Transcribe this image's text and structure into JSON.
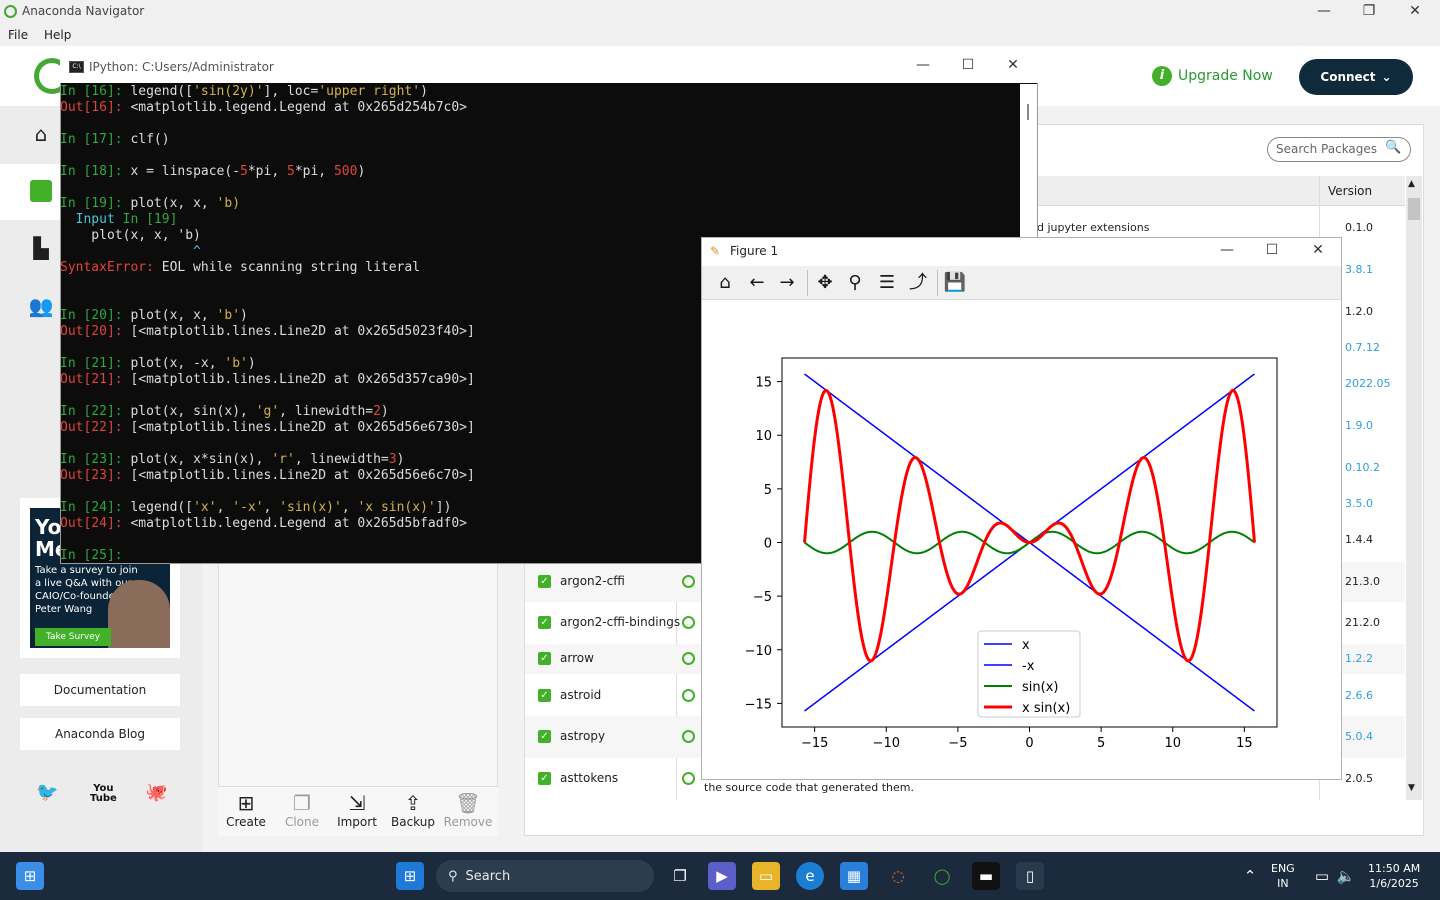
{
  "navigator": {
    "title": "Anaconda Navigator",
    "menu": [
      "File",
      "Help"
    ],
    "upgrade_label": "Upgrade Now",
    "connect_label": "Connect",
    "promo": {
      "headline": "Yo\nMe",
      "body": "Take a survey to join a live Q&A with our CAIO/Co-founder, Peter Wang",
      "button": "Take Survey"
    },
    "links": [
      "Documentation",
      "Anaconda Blog"
    ],
    "env_tools": [
      {
        "label": "Create",
        "icon": "plus-square-icon",
        "enabled": true
      },
      {
        "label": "Clone",
        "icon": "clone-icon",
        "enabled": false
      },
      {
        "label": "Import",
        "icon": "import-icon",
        "enabled": true
      },
      {
        "label": "Backup",
        "icon": "upload-icon",
        "enabled": true
      },
      {
        "label": "Remove",
        "icon": "trash-icon",
        "enabled": false
      }
    ],
    "search_placeholder": "Search Packages",
    "version_header": "Version",
    "top_description": "d jupyter extensions",
    "bottom_description": "the source code that generated them.",
    "versions_top": [
      {
        "v": "0.1.0",
        "update": false
      },
      {
        "v": "3.8.1",
        "update": true
      },
      {
        "v": "1.2.0",
        "update": false
      },
      {
        "v": "0.7.12",
        "update": true
      },
      {
        "v": "2022.05",
        "update": true
      },
      {
        "v": "1.9.0",
        "update": true
      },
      {
        "v": "0.10.2",
        "update": true
      },
      {
        "v": "3.5.0",
        "update": true
      },
      {
        "v": "1.4.4",
        "update": false
      }
    ],
    "packages": [
      {
        "name": "argon2-cffi",
        "version": "21.3.0",
        "update": false
      },
      {
        "name": "argon2-cffi-bindings",
        "version": "21.2.0",
        "update": false
      },
      {
        "name": "arrow",
        "version": "1.2.2",
        "update": true
      },
      {
        "name": "astroid",
        "version": "2.6.6",
        "update": true
      },
      {
        "name": "astropy",
        "version": "5.0.4",
        "update": true
      },
      {
        "name": "asttokens",
        "version": "2.0.5",
        "update": false
      }
    ]
  },
  "ipython": {
    "title": "IPython: C:Users/Administrator",
    "lines": [
      [
        [
          "c-in",
          "In [16]: "
        ],
        [
          "",
          "legend(["
        ],
        [
          "c-str",
          "'sin(2y)'"
        ],
        [
          "",
          "], loc="
        ],
        [
          "c-str",
          "'upper right'"
        ],
        [
          "",
          ")"
        ]
      ],
      [
        [
          "c-out",
          "Out[16]: "
        ],
        [
          "",
          "<matplotlib.legend.Legend at 0x265d254b7c0>"
        ]
      ],
      [],
      [
        [
          "c-in",
          "In [17]: "
        ],
        [
          "",
          "clf()"
        ]
      ],
      [],
      [
        [
          "c-in",
          "In [18]: "
        ],
        [
          "",
          "x = linspace(-"
        ],
        [
          "c-num",
          "5"
        ],
        [
          "",
          "*pi, "
        ],
        [
          "c-num",
          "5"
        ],
        [
          "",
          "*pi, "
        ],
        [
          "c-num",
          "500"
        ],
        [
          "",
          ")"
        ]
      ],
      [],
      [
        [
          "c-in",
          "In [19]: "
        ],
        [
          "",
          "plot(x, x, "
        ],
        [
          "c-str",
          "'b)"
        ]
      ],
      [
        [
          "c-cyan",
          "  Input "
        ],
        [
          "c-in",
          "In [19]"
        ]
      ],
      [
        [
          "",
          "    plot(x, x, 'b)"
        ]
      ],
      [
        [
          "c-cyan",
          "                 ^"
        ]
      ],
      [
        [
          "c-err",
          "SyntaxError:"
        ],
        [
          "",
          " EOL while scanning string literal"
        ]
      ],
      [],
      [],
      [
        [
          "c-in",
          "In [20]: "
        ],
        [
          "",
          "plot(x, x, "
        ],
        [
          "c-str",
          "'b'"
        ],
        [
          "",
          ")"
        ]
      ],
      [
        [
          "c-out",
          "Out[20]: "
        ],
        [
          "",
          "[<matplotlib.lines.Line2D at 0x265d5023f40>]"
        ]
      ],
      [],
      [
        [
          "c-in",
          "In [21]: "
        ],
        [
          "",
          "plot(x, -x, "
        ],
        [
          "c-str",
          "'b'"
        ],
        [
          "",
          ")"
        ]
      ],
      [
        [
          "c-out",
          "Out[21]: "
        ],
        [
          "",
          "[<matplotlib.lines.Line2D at 0x265d357ca90>]"
        ]
      ],
      [],
      [
        [
          "c-in",
          "In [22]: "
        ],
        [
          "",
          "plot(x, sin(x), "
        ],
        [
          "c-str",
          "'g'"
        ],
        [
          "",
          ", linewidth="
        ],
        [
          "c-num",
          "2"
        ],
        [
          "",
          ")"
        ]
      ],
      [
        [
          "c-out",
          "Out[22]: "
        ],
        [
          "",
          "[<matplotlib.lines.Line2D at 0x265d56e6730>]"
        ]
      ],
      [],
      [
        [
          "c-in",
          "In [23]: "
        ],
        [
          "",
          "plot(x, x*sin(x), "
        ],
        [
          "c-str",
          "'r'"
        ],
        [
          "",
          ", linewidth="
        ],
        [
          "c-num",
          "3"
        ],
        [
          "",
          ")"
        ]
      ],
      [
        [
          "c-out",
          "Out[23]: "
        ],
        [
          "",
          "[<matplotlib.lines.Line2D at 0x265d56e6c70>]"
        ]
      ],
      [],
      [
        [
          "c-in",
          "In [24]: "
        ],
        [
          "",
          "legend(["
        ],
        [
          "c-str",
          "'x'"
        ],
        [
          "",
          ", "
        ],
        [
          "c-str",
          "'-x'"
        ],
        [
          "",
          ", "
        ],
        [
          "c-str",
          "'sin(x)'"
        ],
        [
          "",
          ", "
        ],
        [
          "c-str",
          "'x sin(x)'"
        ],
        [
          "",
          "])"
        ]
      ],
      [
        [
          "c-out",
          "Out[24]: "
        ],
        [
          "",
          "<matplotlib.legend.Legend at 0x265d5bfadf0>"
        ]
      ],
      [],
      [
        [
          "c-in",
          "In [25]: "
        ]
      ]
    ]
  },
  "figure": {
    "title": "Figure 1",
    "toolbar": [
      "home-icon",
      "back-arrow-icon",
      "forward-arrow-icon",
      "pan-icon",
      "zoom-icon",
      "configure-subplots-icon",
      "edit-axis-icon",
      "save-icon"
    ]
  },
  "chart_data": {
    "type": "line",
    "x_range": [
      -15.708,
      15.708
    ],
    "samples": 500,
    "xlim": [
      -17.28,
      17.28
    ],
    "ylim": [
      -17.2,
      17.2
    ],
    "xticks": [
      -15,
      -10,
      -5,
      0,
      5,
      10,
      15
    ],
    "yticks": [
      -15,
      -10,
      -5,
      0,
      5,
      10,
      15
    ],
    "xtick_labels": [
      "−15",
      "−10",
      "−5",
      "0",
      "5",
      "10",
      "15"
    ],
    "ytick_labels": [
      "−15",
      "−10",
      "−5",
      "0",
      "5",
      "10",
      "15"
    ],
    "legend_position": "lower center",
    "series": [
      {
        "name": "x",
        "function": "x",
        "color": "#0000ff",
        "linewidth": 1.5
      },
      {
        "name": "-x",
        "function": "-x",
        "color": "#0000ff",
        "linewidth": 1.5
      },
      {
        "name": "sin(x)",
        "function": "sin(x)",
        "color": "#008000",
        "linewidth": 2
      },
      {
        "name": "x sin(x)",
        "function": "x*sin(x)",
        "color": "#ff0000",
        "linewidth": 3
      }
    ]
  },
  "taskbar": {
    "search_label": "Search",
    "lang": "ENG",
    "region": "IN",
    "time": "11:50 AM",
    "date": "1/6/2025"
  }
}
